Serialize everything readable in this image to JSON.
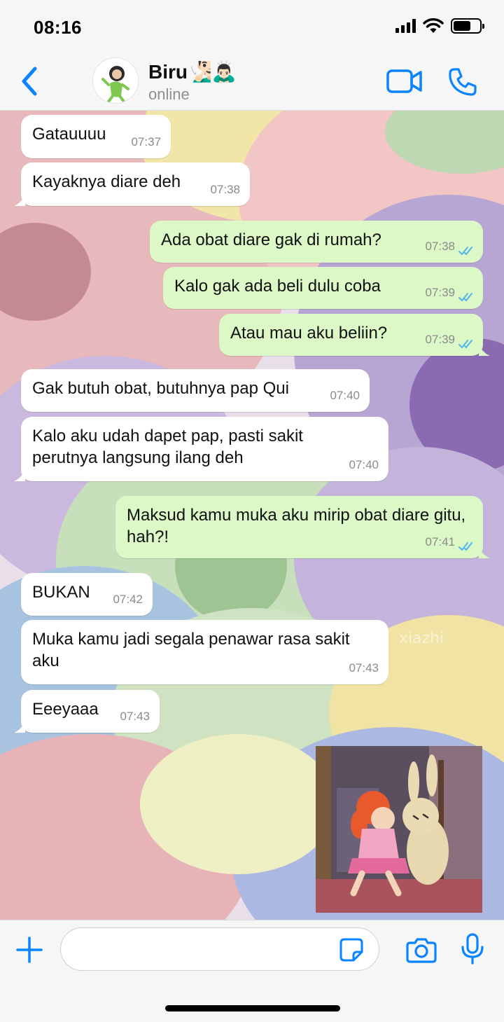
{
  "status_bar": {
    "time": "08:16"
  },
  "header": {
    "contact_name": "Biru🧏🏻‍♂️🙇🏻‍♂️",
    "contact_status": "online"
  },
  "messages": [
    {
      "direction": "in",
      "text": "Gatauuuu",
      "time": "07:37"
    },
    {
      "direction": "in",
      "text": "Kayaknya diare deh",
      "time": "07:38"
    },
    {
      "direction": "out",
      "text": "Ada obat diare gak di rumah?",
      "time": "07:38"
    },
    {
      "direction": "out",
      "text": "Kalo gak ada beli dulu coba",
      "time": "07:39"
    },
    {
      "direction": "out",
      "text": "Atau mau aku beliin?",
      "time": "07:39"
    },
    {
      "direction": "in",
      "text": "Gak butuh obat, butuhnya pap Qui",
      "time": "07:40"
    },
    {
      "direction": "in",
      "text": "Kalo aku udah dapet pap, pasti sakit perutnya langsung ilang deh",
      "time": "07:40"
    },
    {
      "direction": "out",
      "text": "Maksud kamu muka aku mirip obat diare gitu, hah?!",
      "time": "07:41"
    },
    {
      "direction": "in",
      "text": "BUKAN",
      "time": "07:42"
    },
    {
      "direction": "in",
      "text": "Muka kamu jadi segala penawar rasa sakit aku",
      "time": "07:43"
    },
    {
      "direction": "in",
      "text": "Eeeyaaa",
      "time": "07:43"
    }
  ],
  "wallpaper_watermark": "xiazhi",
  "input": {
    "placeholder": ""
  },
  "colors": {
    "accent": "#0a84ff",
    "outgoing_bubble": "#dcf8c6",
    "incoming_bubble": "#ffffff",
    "read_ticks": "#4fb6ec"
  }
}
